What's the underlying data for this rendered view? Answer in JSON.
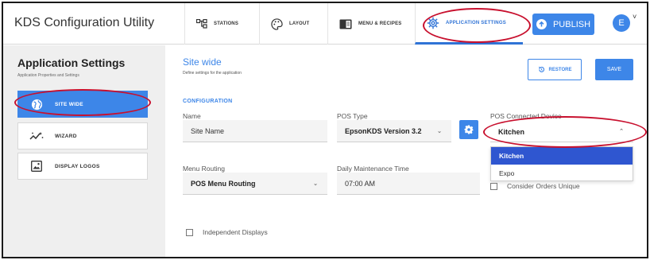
{
  "app": {
    "title": "KDS Configuration Utility"
  },
  "nav": {
    "items": [
      {
        "label": "STATIONS",
        "icon": "stations-icon"
      },
      {
        "label": "LAYOUT",
        "icon": "palette-icon"
      },
      {
        "label": "MENU & RECIPES",
        "icon": "book-icon"
      },
      {
        "label": "APPLICATION SETTINGS",
        "icon": "gear-icon"
      }
    ],
    "active": "APPLICATION SETTINGS",
    "publish_label": "PUBLISH",
    "avatar_initial": "E",
    "avatar_caret": "˅"
  },
  "sidebar": {
    "title": "Application Settings",
    "subtitle": "Application Properties and Settings",
    "items": [
      {
        "label": "SITE WIDE",
        "icon": "globe-icon",
        "active": true
      },
      {
        "label": "WIZARD",
        "icon": "wand-icon",
        "active": false
      },
      {
        "label": "DISPLAY LOGOS",
        "icon": "image-icon",
        "active": false
      }
    ]
  },
  "main": {
    "title": "Site wide",
    "subtitle": "Define settings for the application",
    "restore_label": "RESTORE",
    "save_label": "SAVE",
    "config_heading": "CONFIGURATION",
    "fields": {
      "name": {
        "label": "Name",
        "value": "Site Name"
      },
      "pos_type": {
        "label": "POS Type",
        "value": "EpsonKDS Version 3.2"
      },
      "pos_device": {
        "label": "POS Connected Device",
        "value": "Kitchen"
      },
      "menu_routing": {
        "label": "Menu Routing",
        "value": "POS Menu Routing"
      },
      "maintenance_time": {
        "label": "Daily Maintenance Time",
        "value": "07:00 AM"
      }
    },
    "device_options": [
      "Kitchen",
      "Expo"
    ],
    "checkboxes": {
      "orders_unique": "Consider Orders Unique",
      "independent_displays": "Independent Displays"
    }
  },
  "colors": {
    "accent": "#3d86e8",
    "selected_option": "#2f56d0",
    "annotation": "#c8102e",
    "sidebar_bg": "#efefef"
  }
}
